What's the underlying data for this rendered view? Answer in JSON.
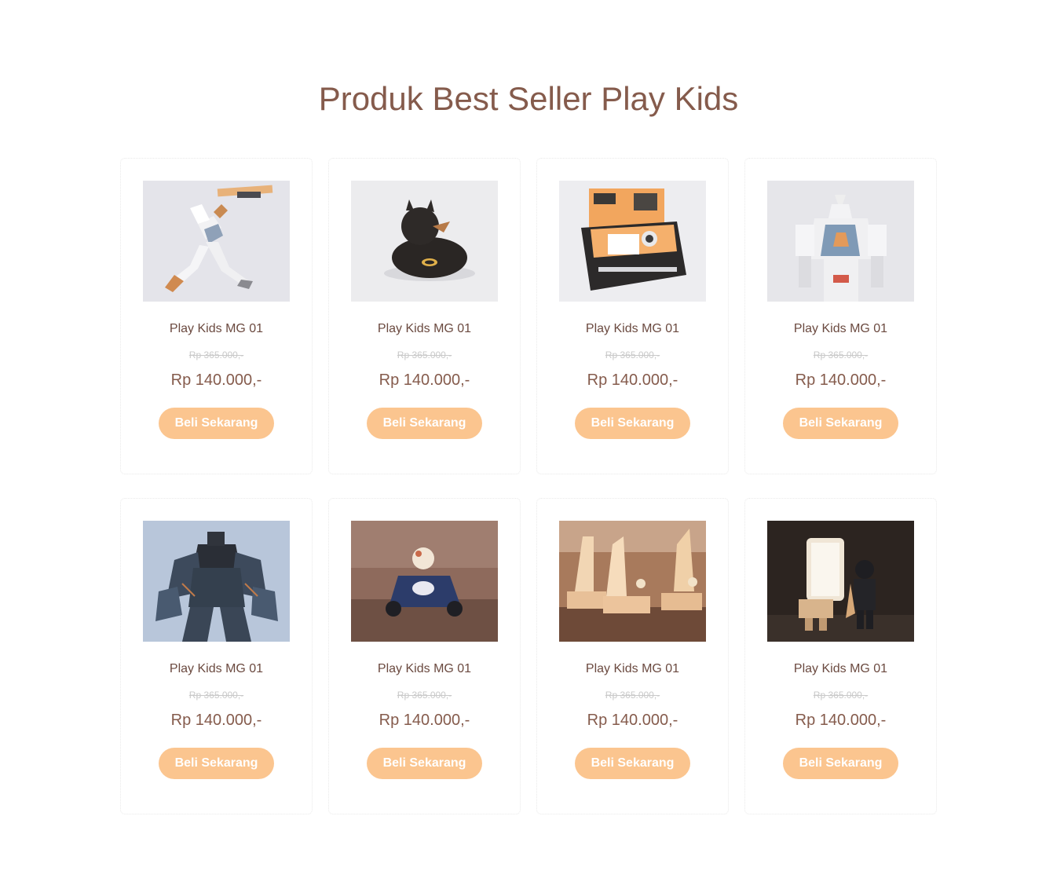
{
  "section": {
    "title": "Produk Best Seller Play Kids"
  },
  "colors": {
    "title": "#855b4c",
    "button_bg": "#fbc58f",
    "button_text": "#ffffff",
    "old_price": "#c9c9c9"
  },
  "products": [
    {
      "name": "Play Kids MG 01",
      "old_price": "Rp 365.000,-",
      "price": "Rp 140.000,-",
      "button": "Beli Sekarang",
      "image": "gundam-figure-flying"
    },
    {
      "name": "Play Kids MG 01",
      "old_price": "Rp 365.000,-",
      "price": "Rp 140.000,-",
      "button": "Beli Sekarang",
      "image": "batman-rubber-duck"
    },
    {
      "name": "Play Kids MG 01",
      "old_price": "Rp 365.000,-",
      "price": "Rp 140.000,-",
      "button": "Beli Sekarang",
      "image": "polaroid-camera"
    },
    {
      "name": "Play Kids MG 01",
      "old_price": "Rp 365.000,-",
      "price": "Rp 140.000,-",
      "button": "Beli Sekarang",
      "image": "gundam-figure-standing"
    },
    {
      "name": "Play Kids MG 01",
      "old_price": "Rp 365.000,-",
      "price": "Rp 140.000,-",
      "button": "Beli Sekarang",
      "image": "dark-robot-figure"
    },
    {
      "name": "Play Kids MG 01",
      "old_price": "Rp 365.000,-",
      "price": "Rp 140.000,-",
      "button": "Beli Sekarang",
      "image": "toad-kart-toy"
    },
    {
      "name": "Play Kids MG 01",
      "old_price": "Rp 365.000,-",
      "price": "Rp 140.000,-",
      "button": "Beli Sekarang",
      "image": "lego-sailboats"
    },
    {
      "name": "Play Kids MG 01",
      "old_price": "Rp 365.000,-",
      "price": "Rp 140.000,-",
      "button": "Beli Sekarang",
      "image": "lego-darth-vader"
    }
  ]
}
